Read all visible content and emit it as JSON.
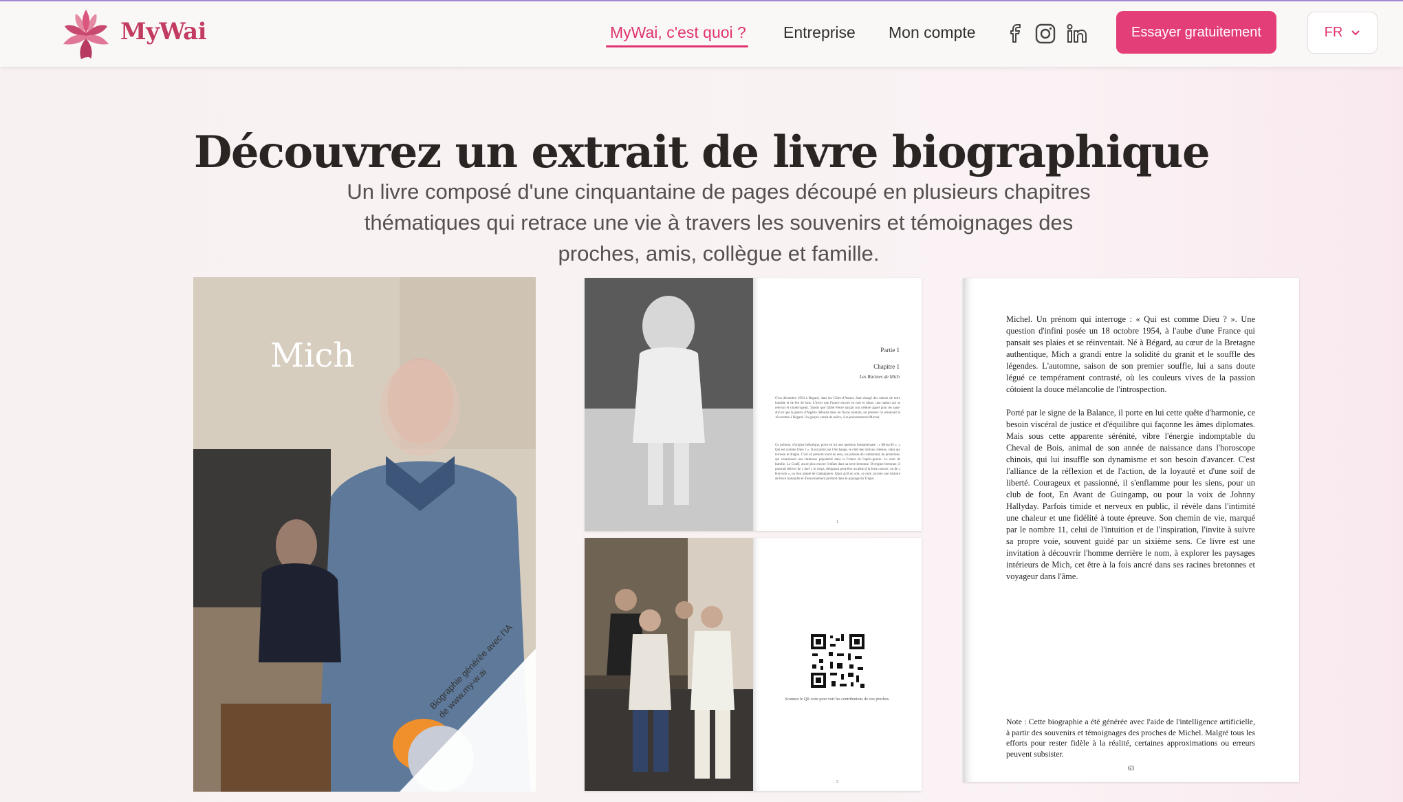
{
  "header": {
    "brand": "MyWai",
    "nav": [
      "MyWai, c'est quoi ?",
      "Entreprise",
      "Mon compte"
    ],
    "cta": "Essayer gratuitement",
    "lang": "FR"
  },
  "hero": {
    "title": "Découvrez un extrait de livre biographique",
    "subtitle": "Un livre composé d'une cinquantaine de pages découpé en plusieurs chapitres thématiques qui retrace une vie à travers les souvenirs et témoignages des proches, amis, collègue et famille."
  },
  "cover": {
    "name": "Mich",
    "ribbon": "Biographie générée avec l'IA de www.my-w.ai"
  },
  "spread1": {
    "part": "Partie 1",
    "chapter": "Chapitre 1",
    "chapter_title": "Les Racines de Mich",
    "para1": "C'est décembre 1954 à Bégard, dans les Côtes-d'Armor, était chargé des odeurs de terre humide et de feu de bois. L'hiver une France encore en noir et blanc, une nation qui se relevait et s'interrogeait. Tandis que l'abbé Pierre lançait son célèbre appel pour les sans-abri et que la guerre d'Algérie débutait dans un fracas lointain, un premier cri résonnait le 18 octobre à Bégard. Un garçon venait de naître, il se prénommerait Michel.",
    "para2": "Ce prénom, d'origine hébraïque, porte en lui une question fondamentale : « Mi-ka-El », « Qui est comme Dieu ? ». Il est porté par l'Archange, le chef des milices célestes, celui qui terrasse le dragon. C'est un prénom lourd de sens, un prénom de combattant, de protecteur, qui connaissait une immense popularité dans la France de l'après-guerre. Le nom de famille, Le Cunff, ancre plus encore l'enfant dans sa terre bretonne. D'origine bretonne, il pourrait dériver de « kerf » le corps, désignant peut-être un aïeul à la forte carrure, ou de « Kervoch », un lieu planté de châtaigniers. Quoi qu'il en soit, ce nom raconte une histoire de force tranquille et d'enracinement profond dans le paysage du Trégor.",
    "footer": "1"
  },
  "spread2": {
    "qr_caption": "Scannez le QR code pour voir les contributions de vos proches.",
    "footer": "2"
  },
  "bookpage": {
    "para1": "Michel. Un prénom qui interroge : « Qui est comme Dieu ? ». Une question d'infini posée un 18 octobre 1954, à l'aube d'une France qui pansait ses plaies et se réinventait. Né à Bégard, au cœur de la Bretagne authentique, Mich a grandi entre la solidité du granit et le souffle des légendes. L'automne, saison de son premier souffle, lui a sans doute légué ce tempérament contrasté, où les couleurs vives de la passion côtoient la douce mélancolie de l'introspection.",
    "para2": "Porté par le signe de la Balance, il porte en lui cette quête d'harmonie, ce besoin viscéral de justice et d'équilibre qui façonne les âmes diplomates. Mais sous cette apparente sérénité, vibre l'énergie indomptable du Cheval de Bois, animal de son année de naissance dans l'horoscope chinois, qui lui insuffle son dynamisme et son besoin d'avancer. C'est l'alliance de la réflexion et de l'action, de la loyauté et d'une soif de liberté. Courageux et passionné, il s'enflamme pour les siens, pour un club de foot, En Avant de Guingamp, ou pour la voix de Johnny Hallyday. Parfois timide et nerveux en public, il révèle dans l'intimité une chaleur et une fidélité à toute épreuve. Son chemin de vie, marqué par le nombre 11, celui de l'intuition et de l'inspiration, l'invite à suivre sa propre voie, souvent guidé par un sixième sens. Ce livre est une invitation à découvrir l'homme derrière le nom, à explorer les paysages intérieurs de Mich, cet être à la fois ancré dans ses racines bretonnes et voyageur dans l'âme.",
    "note": "Note : Cette biographie a été générée avec l'aide de l'intelligence artificielle, à partir des souvenirs et témoignages des proches de Michel. Malgré tous les efforts pour rester fidèle à la réalité, certaines approximations ou erreurs peuvent subsister.",
    "page_number": "63"
  },
  "colors": {
    "accent": "#e43e78",
    "brand": "#c23b61",
    "active_nav": "#e0336f"
  },
  "icons": [
    "logo-lotus-icon",
    "facebook-icon",
    "instagram-icon",
    "linkedin-icon",
    "chevron-down-icon",
    "qr-code-icon"
  ]
}
